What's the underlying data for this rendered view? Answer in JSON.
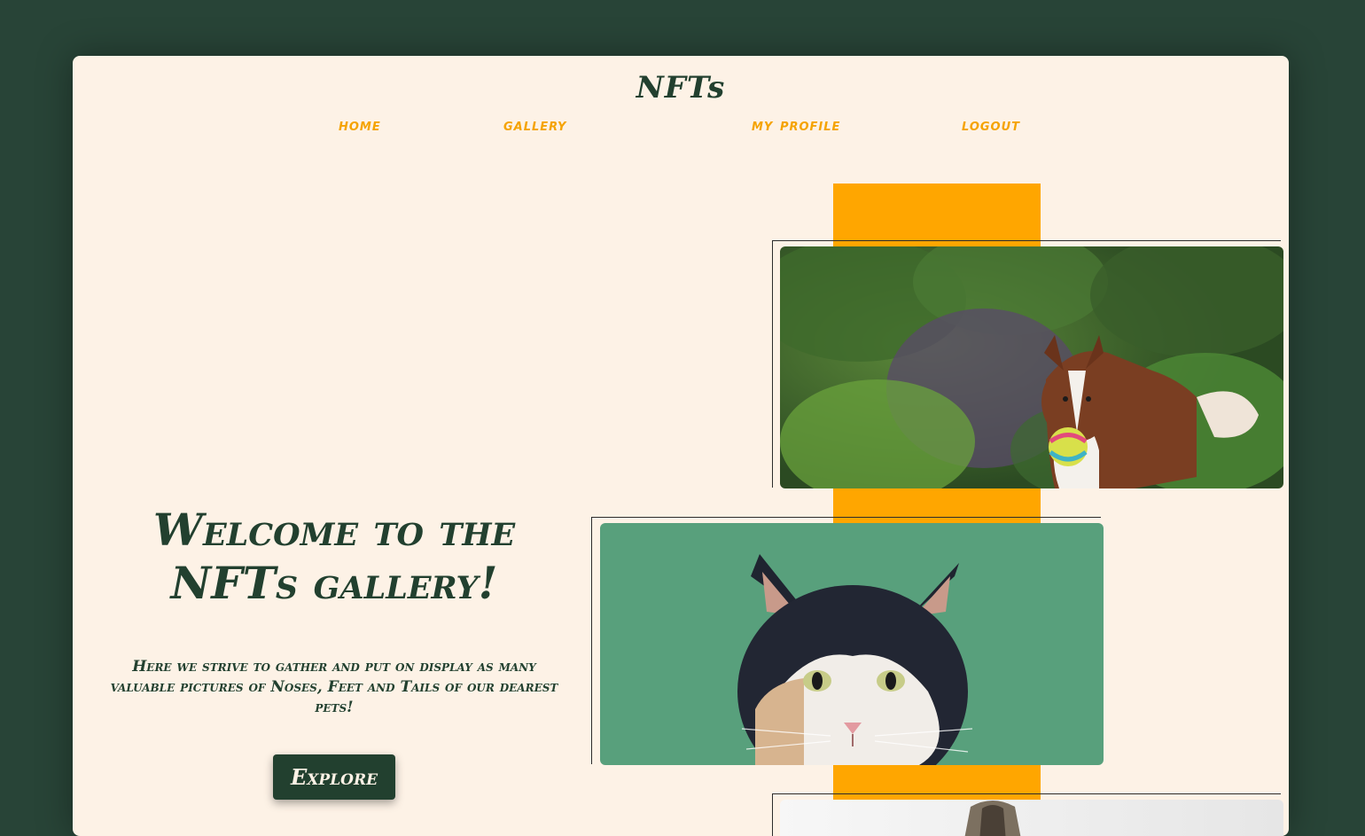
{
  "header": {
    "brand": "NFTs"
  },
  "nav": {
    "items": [
      "home",
      "gallery",
      "my profile",
      "logout"
    ]
  },
  "hero": {
    "title": "Welcome to the NFTs gallery!",
    "description": "Here we strive to gather and put on display as many valuable pictures of Noses, Feet and Tails of our dearest pets!",
    "button_label": "Explore"
  },
  "gallery": {
    "photos": [
      "dog-photo",
      "cat-photo",
      "pet-photo"
    ]
  },
  "colors": {
    "page_bg": "#284437",
    "card_bg": "#fdf2e6",
    "dark_green": "#22402f",
    "accent_orange": "#ffa600",
    "nav_orange": "#f5a300"
  }
}
